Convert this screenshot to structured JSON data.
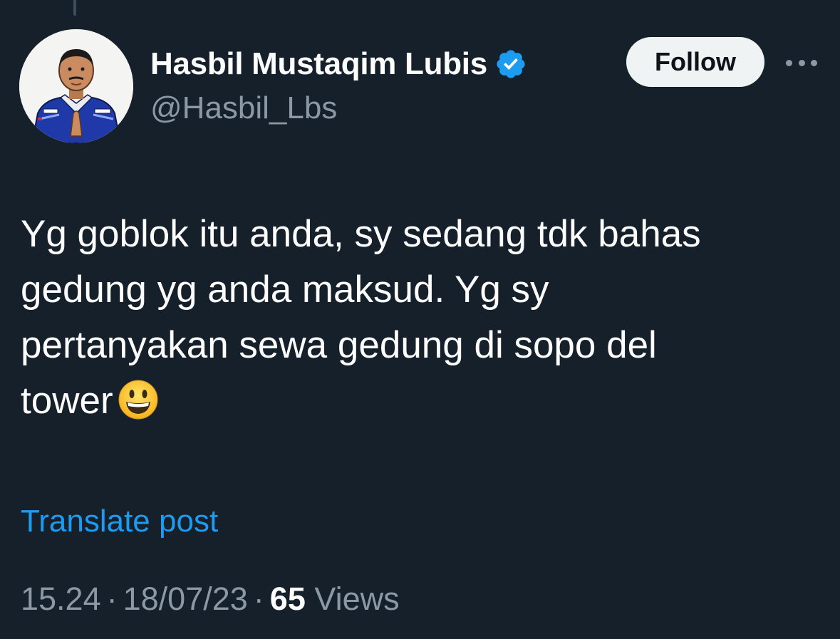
{
  "tweet": {
    "author": {
      "display_name": "Hasbil Mustaqim Lubis",
      "handle": "@Hasbil_Lbs",
      "verified_icon": "verified-badge-icon",
      "avatar_icon": "avatar-illustration"
    },
    "follow_label": "Follow",
    "more_icon": "more-options-icon",
    "text_lines": [
      "Yg goblok itu anda, sy sedang tdk bahas",
      "gedung yg anda maksud. Yg sy",
      "pertanyakan sewa gedung di sopo del",
      "tower"
    ],
    "emoji": "😀",
    "translate_label": "Translate post",
    "time": "15.24",
    "date": "18/07/23",
    "views_count": "65",
    "views_label": "Views",
    "separator": "·"
  },
  "colors": {
    "background": "#15202b",
    "accent": "#1d9bf0",
    "muted": "#8b98a5",
    "text": "#ffffff",
    "follow_bg": "#eff3f4"
  }
}
